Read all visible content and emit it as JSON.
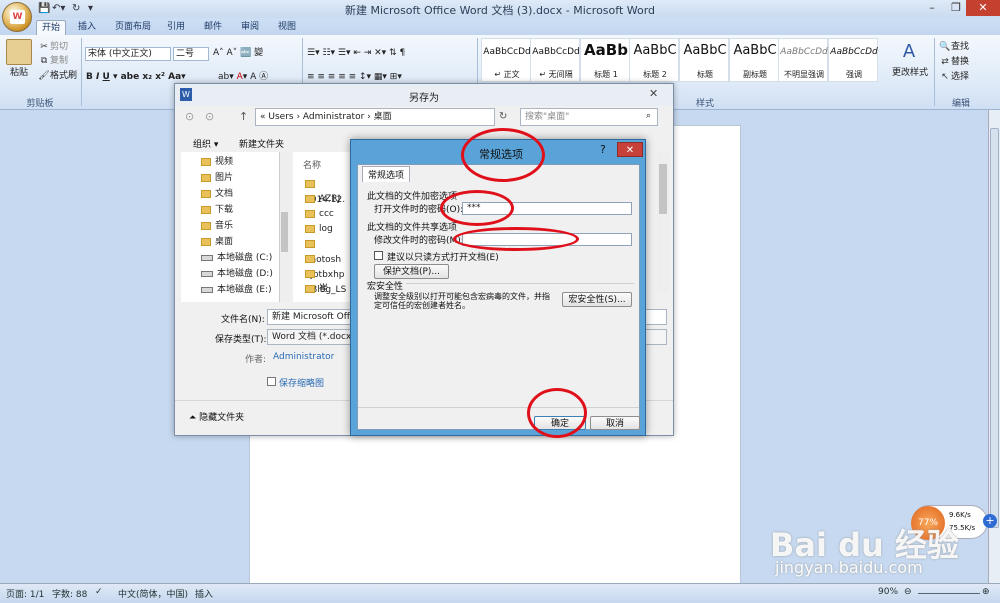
{
  "window": {
    "title": "新建 Microsoft Office Word 文档 (3).docx - Microsoft Word"
  },
  "ribbon": {
    "tabs": [
      "开始",
      "插入",
      "页面布局",
      "引用",
      "邮件",
      "审阅",
      "视图"
    ],
    "clipboard": {
      "paste": "粘贴",
      "cut": "剪切",
      "copy": "复制",
      "format_painter": "格式刷",
      "group": "剪贴板"
    },
    "font": {
      "name": "宋体 (中文正文)",
      "size": "二号"
    },
    "styles": [
      {
        "sample": "AaBbCcDd",
        "name": "↵ 正文"
      },
      {
        "sample": "AaBbCcDd",
        "name": "↵ 无间隔"
      },
      {
        "sample": "AaBb",
        "name": "标题 1"
      },
      {
        "sample": "AaBbC",
        "name": "标题 2"
      },
      {
        "sample": "AaBbC",
        "name": "标题"
      },
      {
        "sample": "AaBbC",
        "name": "副标题"
      },
      {
        "sample": "AaBbCcDd",
        "name": "不明显强调"
      },
      {
        "sample": "AaBbCcDd",
        "name": "强调"
      }
    ],
    "change_styles": "更改样式",
    "styles_group": "样式",
    "editing": {
      "find": "查找",
      "replace": "替换",
      "select": "选择",
      "group": "编辑"
    }
  },
  "save_dialog": {
    "title": "另存为",
    "path": [
      "«",
      "Users",
      "Administrator",
      "桌面"
    ],
    "search_placeholder": "搜索\"桌面\"",
    "organize": "组织",
    "new_folder": "新建文件夹",
    "nav_items": [
      {
        "label": "视频",
        "kind": "folder"
      },
      {
        "label": "图片",
        "kind": "folder"
      },
      {
        "label": "文档",
        "kind": "folder"
      },
      {
        "label": "下载",
        "kind": "folder"
      },
      {
        "label": "音乐",
        "kind": "folder"
      },
      {
        "label": "桌面",
        "kind": "folder"
      },
      {
        "label": "本地磁盘 (C:)",
        "kind": "drive"
      },
      {
        "label": "本地磁盘 (D:)",
        "kind": "drive"
      },
      {
        "label": "本地磁盘 (E:)",
        "kind": "drive"
      }
    ],
    "column_name": "名称",
    "files": [
      "2014.12.",
      "AZRJ",
      "ccc",
      "log",
      "Photosh",
      "xjbtbxhp",
      "ZBlog_LS",
      "崔"
    ],
    "filename_label": "文件名(N):",
    "filename_value": "新建 Microsoft Office",
    "filetype_label": "保存类型(T):",
    "filetype_value": "Word 文档 (*.docx)",
    "author_label": "作者:",
    "author_value": "Administrator",
    "thumbnail_label": "保存缩略图",
    "hide_folders": "隐藏文件夹"
  },
  "options_dialog": {
    "title": "常规选项",
    "help": "?",
    "tab": "常规选项",
    "encrypt_section": "此文档的文件加密选项",
    "open_password_label": "打开文件时的密码(O):",
    "open_password_value": "***",
    "share_section": "此文档的文件共享选项",
    "modify_password_label": "修改文件时的密码(M):",
    "modify_password_value": "",
    "readonly_label": "建议以只读方式打开文档(E)",
    "protect_button": "保护文档(P)...",
    "macro_section": "宏安全性",
    "macro_text": "调整安全级别以打开可能包含宏病毒的文件，并指定可信任的宏创建者姓名。",
    "macro_button": "宏安全性(S)...",
    "ok": "确定",
    "cancel": "取消"
  },
  "status_bar": {
    "page": "页面: 1/1",
    "words": "字数: 88",
    "language": "中文(简体，中国)",
    "insert": "插入",
    "zoom": "90%"
  },
  "speed_widget": {
    "percent": "77%",
    "up": "9.6K/s",
    "down": "75.5K/s"
  },
  "watermark": {
    "brand": "Bai du 经验",
    "url": "jingyan.baidu.com"
  }
}
